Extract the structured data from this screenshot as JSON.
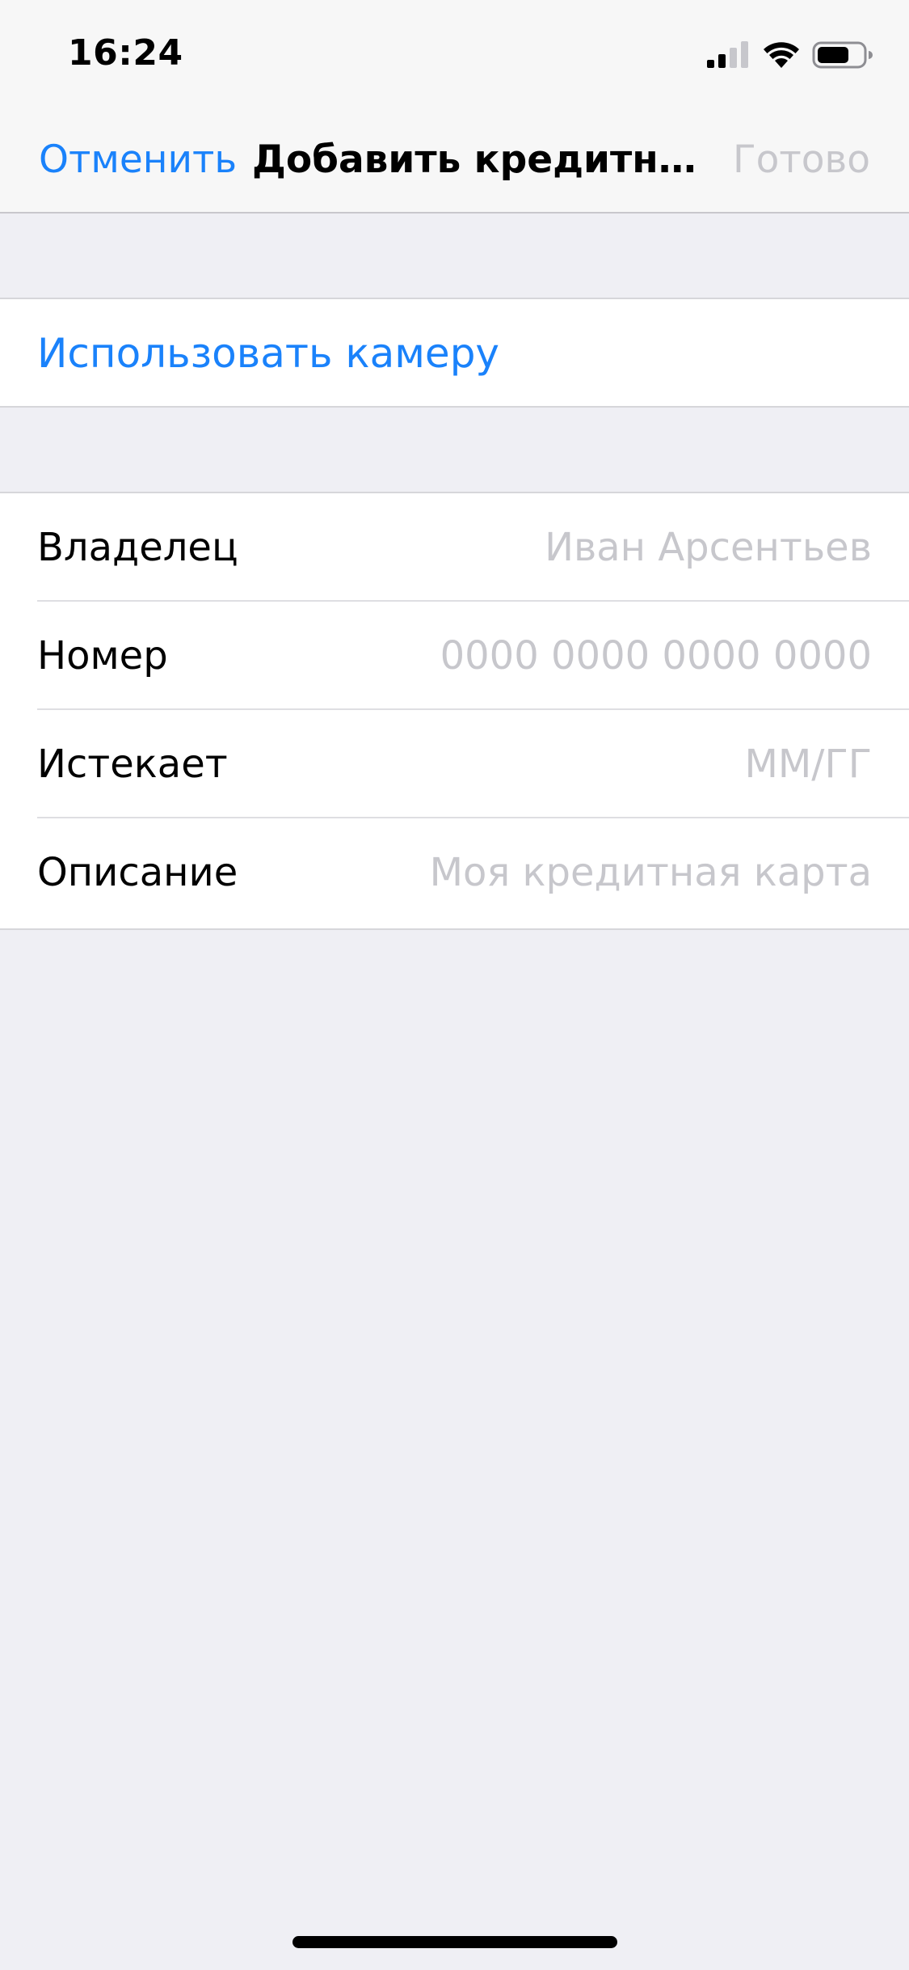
{
  "status_bar": {
    "time": "16:24",
    "icons": [
      "cellular-signal-icon",
      "wifi-icon",
      "battery-icon"
    ]
  },
  "nav": {
    "cancel_label": "Отменить",
    "title": "Добавить кредитную…",
    "done_label": "Готово"
  },
  "camera": {
    "label": "Использовать камеру"
  },
  "form": {
    "rows": [
      {
        "label": "Владелец",
        "placeholder": "Иван Арсентьев",
        "value": ""
      },
      {
        "label": "Номер",
        "placeholder": "0000 0000 0000 0000",
        "value": ""
      },
      {
        "label": "Истекает",
        "placeholder": "ММ/ГГ",
        "value": ""
      },
      {
        "label": "Описание",
        "placeholder": "Моя кредитная карта",
        "value": ""
      }
    ]
  },
  "colors": {
    "accent": "#1a82fb",
    "disabled": "#c7c7cc",
    "background": "#efeff4",
    "bar": "#f7f7f7"
  }
}
